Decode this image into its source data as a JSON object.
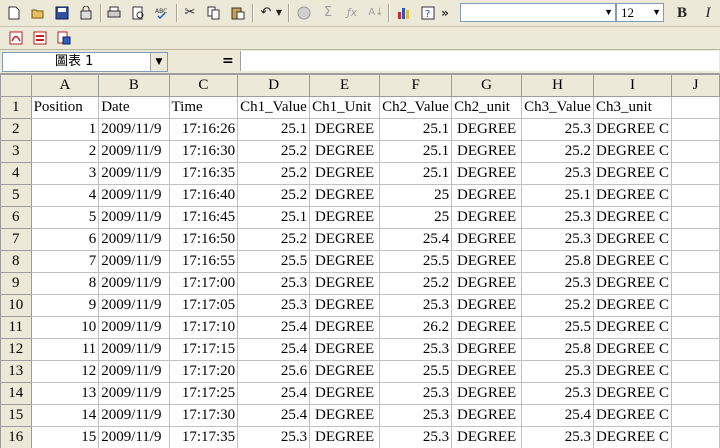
{
  "toolbar1": {
    "icons": [
      "new-icon",
      "open-icon",
      "save-icon",
      "permission-icon",
      "print-icon",
      "print-preview-icon",
      "spelling-icon",
      "cut-icon",
      "copy-icon",
      "paste-icon",
      "undo-icon",
      "hyperlink-icon",
      "autosum-icon",
      "function-icon",
      "sort-icon",
      "chart-wizard-icon",
      "help-icon",
      "more-icon"
    ],
    "glyphs": {
      "cut": "✂",
      "sigma": "Σ",
      "fx": "ƒx",
      "sort": "A↓",
      "more": "»",
      "undo": "↶",
      "help": "?"
    },
    "font_name": "",
    "font_size": "12",
    "bold_label": "B",
    "italic_label": "I"
  },
  "toolbar2": {
    "icons": [
      "pdf-icon",
      "pdf-convert-icon",
      "pdf-review-icon"
    ]
  },
  "formula_bar": {
    "name_box": "圖表 1",
    "equals": "=",
    "formula": ""
  },
  "sheet": {
    "columns": [
      "A",
      "B",
      "C",
      "D",
      "E",
      "F",
      "G",
      "H",
      "I",
      "J"
    ],
    "header_row": [
      "Position",
      "Date",
      "Time",
      "Ch1_Value",
      "Ch1_Unit",
      "Ch2_Value",
      "Ch2_unit",
      "Ch3_Value",
      "Ch3_unit",
      ""
    ],
    "rows": [
      [
        "1",
        "2009/11/9",
        "17:16:26",
        "25.1",
        "DEGREE",
        "25.1",
        "DEGREE",
        "25.3",
        "DEGREE C",
        ""
      ],
      [
        "2",
        "2009/11/9",
        "17:16:30",
        "25.2",
        "DEGREE",
        "25.1",
        "DEGREE",
        "25.2",
        "DEGREE C",
        ""
      ],
      [
        "3",
        "2009/11/9",
        "17:16:35",
        "25.2",
        "DEGREE",
        "25.1",
        "DEGREE",
        "25.3",
        "DEGREE C",
        ""
      ],
      [
        "4",
        "2009/11/9",
        "17:16:40",
        "25.2",
        "DEGREE",
        "25",
        "DEGREE",
        "25.1",
        "DEGREE C",
        ""
      ],
      [
        "5",
        "2009/11/9",
        "17:16:45",
        "25.1",
        "DEGREE",
        "25",
        "DEGREE",
        "25.3",
        "DEGREE C",
        ""
      ],
      [
        "6",
        "2009/11/9",
        "17:16:50",
        "25.2",
        "DEGREE",
        "25.4",
        "DEGREE",
        "25.3",
        "DEGREE C",
        ""
      ],
      [
        "7",
        "2009/11/9",
        "17:16:55",
        "25.5",
        "DEGREE",
        "25.5",
        "DEGREE",
        "25.8",
        "DEGREE C",
        ""
      ],
      [
        "8",
        "2009/11/9",
        "17:17:00",
        "25.3",
        "DEGREE",
        "25.2",
        "DEGREE",
        "25.3",
        "DEGREE C",
        ""
      ],
      [
        "9",
        "2009/11/9",
        "17:17:05",
        "25.3",
        "DEGREE",
        "25.3",
        "DEGREE",
        "25.2",
        "DEGREE C",
        ""
      ],
      [
        "10",
        "2009/11/9",
        "17:17:10",
        "25.4",
        "DEGREE",
        "26.2",
        "DEGREE",
        "25.5",
        "DEGREE C",
        ""
      ],
      [
        "11",
        "2009/11/9",
        "17:17:15",
        "25.4",
        "DEGREE",
        "25.3",
        "DEGREE",
        "25.8",
        "DEGREE C",
        ""
      ],
      [
        "12",
        "2009/11/9",
        "17:17:20",
        "25.6",
        "DEGREE",
        "25.5",
        "DEGREE",
        "25.3",
        "DEGREE C",
        ""
      ],
      [
        "13",
        "2009/11/9",
        "17:17:25",
        "25.4",
        "DEGREE",
        "25.3",
        "DEGREE",
        "25.3",
        "DEGREE C",
        ""
      ],
      [
        "14",
        "2009/11/9",
        "17:17:30",
        "25.4",
        "DEGREE",
        "25.3",
        "DEGREE",
        "25.4",
        "DEGREE C",
        ""
      ],
      [
        "15",
        "2009/11/9",
        "17:17:35",
        "25.3",
        "DEGREE",
        "25.3",
        "DEGREE",
        "25.3",
        "DEGREE C",
        ""
      ]
    ]
  }
}
